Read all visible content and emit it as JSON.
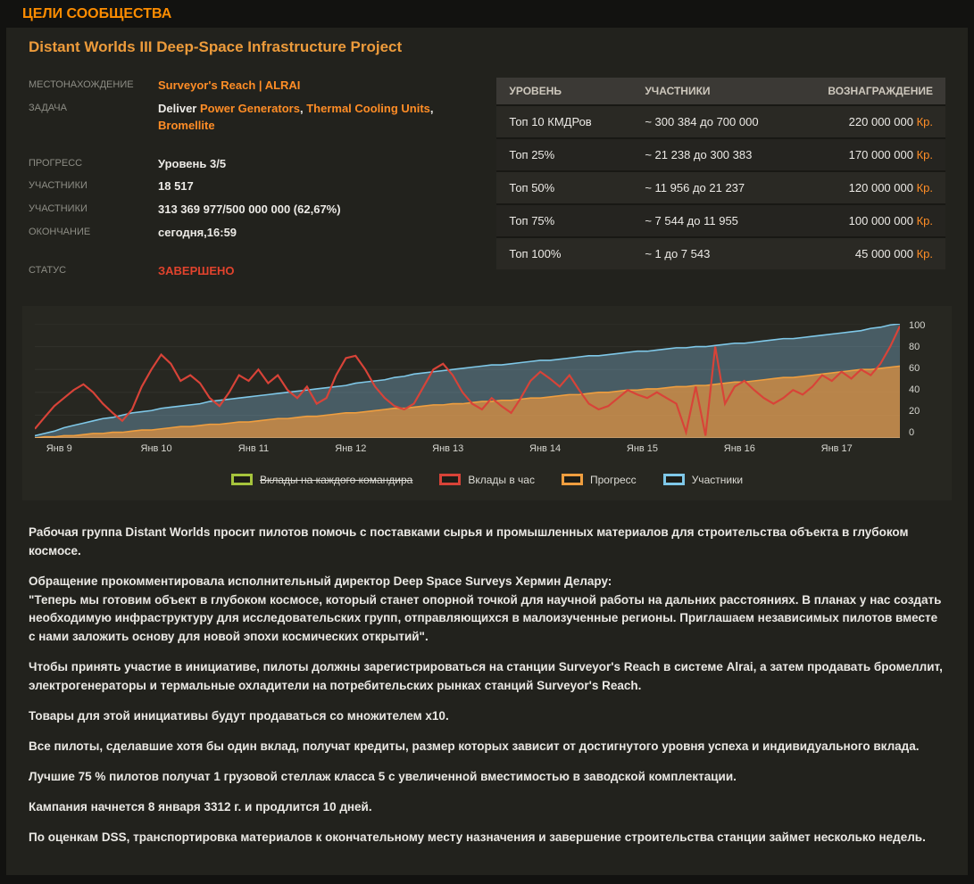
{
  "page_title": "ЦЕЛИ СООБЩЕСТВА",
  "colors": {
    "accent_orange": "#ff8d26",
    "heading_orange": "#ed9b3b",
    "status_completed_red": "#e1432d"
  },
  "goal": {
    "title": "Distant Worlds III Deep-Space Infrastructure Project",
    "details": [
      {
        "label": "МЕСТОНАХОЖДЕНИЕ",
        "parts": [
          {
            "t": "Surveyor's Reach | ALRAI",
            "link": true
          }
        ]
      },
      {
        "label": "ЗАДАЧА",
        "parts": [
          {
            "t": "Deliver "
          },
          {
            "t": "Power Generators",
            "link": true
          },
          {
            "t": ", "
          },
          {
            "t": "Thermal Cooling Units",
            "link": true
          },
          {
            "t": ",\n"
          },
          {
            "t": "Bromellite",
            "link": true
          }
        ]
      },
      {
        "label": "ПРОГРЕСС",
        "gap_before": true,
        "parts": [
          {
            "t": "Уровень 3/5"
          }
        ]
      },
      {
        "label": "УЧАСТНИКИ",
        "parts": [
          {
            "t": "18 517"
          }
        ]
      },
      {
        "label": "УЧАСТНИКИ",
        "parts": [
          {
            "t": "313 369 977/500 000 000 (62,67%)"
          }
        ]
      },
      {
        "label": "ОКОНЧАНИЕ",
        "parts": [
          {
            "t": "сегодня,16:59"
          }
        ]
      },
      {
        "label": "СТАТУС",
        "gap_before": true,
        "parts": [
          {
            "t": "ЗАВЕРШЕНО",
            "status": true
          }
        ]
      }
    ]
  },
  "rewards_table": {
    "headers": [
      "УРОВЕНЬ",
      "УЧАСТНИКИ",
      "ВОЗНАГРАЖДЕНИЕ"
    ],
    "rows": [
      {
        "tier": "Топ 10 КМДРов",
        "range": "~ 300 384 до 700 000",
        "amount": "220 000 000",
        "currency": "Кр."
      },
      {
        "tier": "Топ 25%",
        "range": "~ 21 238 до 300 383",
        "amount": "170 000 000",
        "currency": "Кр."
      },
      {
        "tier": "Топ 50%",
        "range": "~ 11 956 до 21 237",
        "amount": "120 000 000",
        "currency": "Кр."
      },
      {
        "tier": "Топ 75%",
        "range": "~ 7 544 до 11 955",
        "amount": "100 000 000",
        "currency": "Кр."
      },
      {
        "tier": "Топ 100%",
        "range": "~ 1 до 7 543",
        "amount": "45 000 000",
        "currency": "Кр."
      }
    ]
  },
  "chart_data": {
    "type": "line",
    "x_axis": {
      "tick_labels": [
        "Янв 9",
        "Янв 10",
        "Янв 11",
        "Янв 12",
        "Янв 13",
        "Янв 14",
        "Янв 15",
        "Янв 16",
        "Янв 17"
      ]
    },
    "y_axis": {
      "ticks": [
        0,
        20,
        40,
        60,
        80,
        100
      ],
      "min": 0,
      "max": 100,
      "position": "right"
    },
    "draw_order": [
      "participants",
      "progress",
      "per_hour"
    ],
    "series": [
      {
        "id": "per_cmdr",
        "name": "Вклады на каждого командира",
        "color": "#a6c43c",
        "hidden": true,
        "type": "line",
        "values": []
      },
      {
        "id": "per_hour",
        "name": "Вклады в час",
        "color": "#d84338",
        "hidden": false,
        "type": "line",
        "values": [
          8,
          18,
          28,
          35,
          42,
          47,
          40,
          30,
          22,
          15,
          25,
          45,
          60,
          73,
          65,
          50,
          55,
          48,
          35,
          28,
          40,
          55,
          50,
          60,
          48,
          55,
          42,
          35,
          45,
          30,
          35,
          55,
          70,
          72,
          60,
          45,
          35,
          28,
          25,
          30,
          45,
          60,
          65,
          55,
          40,
          30,
          25,
          35,
          28,
          22,
          35,
          50,
          58,
          52,
          45,
          55,
          42,
          30,
          25,
          28,
          35,
          42,
          38,
          35,
          40,
          35,
          30,
          5,
          45,
          2,
          80,
          30,
          45,
          50,
          42,
          35,
          30,
          35,
          42,
          38,
          45,
          55,
          50,
          58,
          52,
          60,
          55,
          65,
          80,
          98
        ]
      },
      {
        "id": "progress",
        "name": "Прогресс",
        "color": "#ef9e3f",
        "hidden": false,
        "type": "area",
        "fill": "rgba(222,145,65,0.75)",
        "values": [
          0,
          1,
          1,
          2,
          2,
          3,
          4,
          4,
          5,
          5,
          6,
          7,
          7,
          8,
          9,
          10,
          10,
          11,
          12,
          12,
          13,
          14,
          14,
          15,
          16,
          17,
          17,
          18,
          19,
          19,
          20,
          21,
          22,
          22,
          23,
          24,
          25,
          26,
          26,
          27,
          28,
          29,
          29,
          30,
          30,
          31,
          32,
          32,
          33,
          33,
          34,
          35,
          35,
          36,
          37,
          38,
          38,
          39,
          40,
          40,
          41,
          42,
          42,
          43,
          43,
          44,
          45,
          45,
          46,
          46,
          47,
          48,
          49,
          49,
          50,
          51,
          52,
          53,
          53,
          54,
          55,
          56,
          57,
          58,
          59,
          60,
          60,
          61,
          62,
          63
        ]
      },
      {
        "id": "participants",
        "name": "Участники",
        "color": "#7fc8e8",
        "hidden": false,
        "type": "area",
        "fill": "rgba(125,180,210,0.38)",
        "values": [
          2,
          4,
          6,
          9,
          11,
          13,
          15,
          17,
          18,
          20,
          22,
          23,
          24,
          26,
          27,
          28,
          29,
          30,
          32,
          33,
          34,
          35,
          36,
          37,
          38,
          39,
          40,
          41,
          42,
          43,
          44,
          45,
          46,
          48,
          49,
          50,
          51,
          53,
          54,
          56,
          57,
          58,
          59,
          60,
          61,
          62,
          63,
          64,
          64,
          65,
          66,
          67,
          68,
          68,
          69,
          70,
          71,
          72,
          72,
          73,
          74,
          75,
          76,
          76,
          77,
          78,
          79,
          79,
          80,
          80,
          81,
          82,
          83,
          83,
          84,
          85,
          86,
          87,
          87,
          88,
          89,
          90,
          91,
          92,
          93,
          94,
          96,
          97,
          99,
          100
        ]
      }
    ]
  },
  "description_paragraphs": [
    "Рабочая группа Distant Worlds просит пилотов помочь с поставками сырья и промышленных материалов для строительства объекта в глубоком космосе.",
    "Обращение прокомментировала исполнительный директор Deep Space Surveys Хермин Делару:\n\"Теперь мы готовим объект в глубоком космосе, который станет опорной точкой для научной работы на дальних расстояниях. В планах у нас создать необходимую инфраструктуру для исследовательских групп, отправляющихся в малоизученные регионы. Приглашаем независимых пилотов вместе с нами заложить основу для новой эпохи космических открытий\".",
    "Чтобы принять участие в инициативе, пилоты должны зарегистрироваться на станции Surveyor's Reach в системе Alrai, а затем продавать бромеллит, электрогенераторы и термальные охладители на потребительских рынках станций Surveyor's Reach.",
    "Товары для этой инициативы будут продаваться со множителем x10.",
    "Все пилоты, сделавшие хотя бы один вклад, получат кредиты, размер которых зависит от достигнутого уровня успеха и индивидуального вклада.",
    "Лучшие 75 % пилотов получат 1 грузовой стеллаж класса 5 с увеличенной вместимостью в заводской комплектации.",
    "Кампания начнется 8 января 3312 г. и продлится 10 дней.",
    "По оценкам DSS, транспортировка материалов к окончательному месту назначения и завершение строительства станции займет несколько недель."
  ]
}
